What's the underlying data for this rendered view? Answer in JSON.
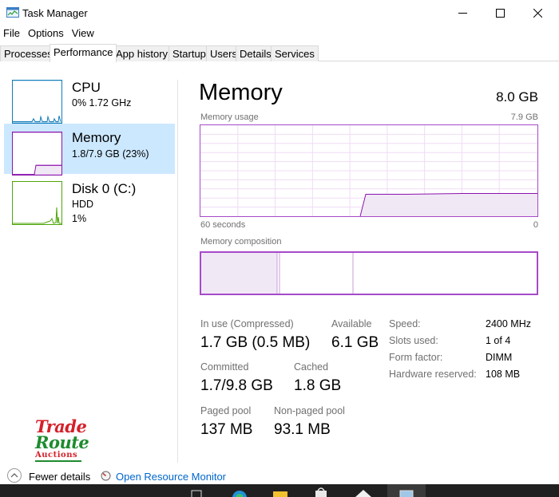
{
  "window": {
    "title": "Task Manager"
  },
  "menu": [
    {
      "label": "File"
    },
    {
      "label": "Options"
    },
    {
      "label": "View"
    }
  ],
  "tabs": [
    {
      "label": "Processes"
    },
    {
      "label": "Performance",
      "active": true
    },
    {
      "label": "App history"
    },
    {
      "label": "Startup"
    },
    {
      "label": "Users"
    },
    {
      "label": "Details"
    },
    {
      "label": "Services"
    }
  ],
  "sidebar": {
    "items": [
      {
        "title": "CPU",
        "line1": "0%  1.72 GHz",
        "line2": "",
        "color": "#117dbb"
      },
      {
        "title": "Memory",
        "line1": "1.8/7.9 GB (23%)",
        "line2": "",
        "color": "#8b12ae",
        "selected": true
      },
      {
        "title": "Disk 0 (C:)",
        "line1": "HDD",
        "line2": "1%",
        "color": "#4da60c"
      }
    ]
  },
  "memory": {
    "title": "Memory",
    "total": "8.0 GB",
    "usage_label": "Memory usage",
    "usage_max": "7.9 GB",
    "time_left": "60 seconds",
    "time_right": "0",
    "composition_label": "Memory composition",
    "stats": {
      "in_use_label": "In use (Compressed)",
      "in_use_value": "1.7 GB (0.5 MB)",
      "available_label": "Available",
      "available_value": "6.1 GB",
      "committed_label": "Committed",
      "committed_value": "1.7/9.8 GB",
      "cached_label": "Cached",
      "cached_value": "1.8 GB",
      "paged_label": "Paged pool",
      "paged_value": "137 MB",
      "nonpaged_label": "Non-paged pool",
      "nonpaged_value": "93.1 MB"
    },
    "details": {
      "speed_label": "Speed:",
      "speed_value": "2400 MHz",
      "slots_label": "Slots used:",
      "slots_value": "1 of 4",
      "form_label": "Form factor:",
      "form_value": "DIMM",
      "reserved_label": "Hardware reserved:",
      "reserved_value": "108 MB"
    },
    "accent": "#8b12ae"
  },
  "logo": {
    "line1": "Trade",
    "line2": "Route",
    "line3": "Auctions"
  },
  "footer": {
    "fewer_details": "Fewer details",
    "resource_monitor": "Open Resource Monitor"
  },
  "icons": {
    "app": "task-manager-icon",
    "minimize": "minimize-icon",
    "maximize": "maximize-icon",
    "close": "close-icon",
    "fewer": "chevron-up-icon",
    "resource_monitor": "resource-monitor-icon"
  }
}
